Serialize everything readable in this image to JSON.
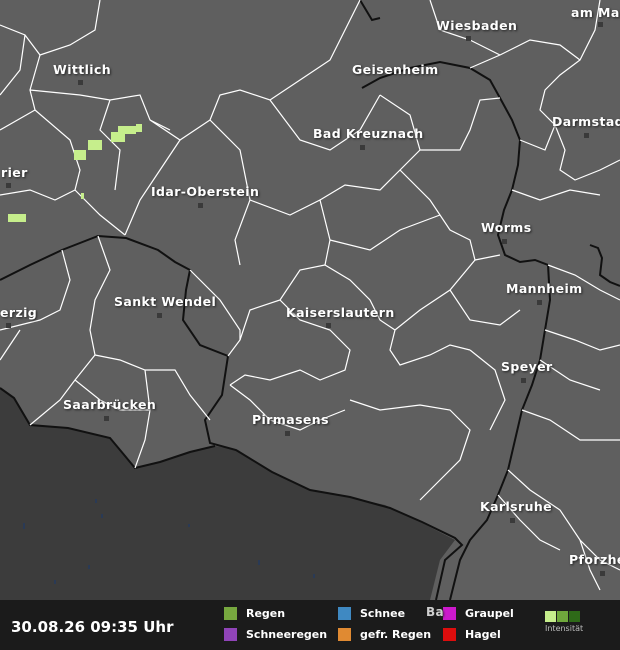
{
  "timestamp": "30.08.26 09:35 Uhr",
  "cities": [
    {
      "name": "Wittlich"
    },
    {
      "name": "Wiesbaden"
    },
    {
      "name": "am Mai"
    },
    {
      "name": "Geisenheim"
    },
    {
      "name": "Bad Kreuznach"
    },
    {
      "name": "Darmstadt"
    },
    {
      "name": "rier"
    },
    {
      "name": "Idar-Oberstein"
    },
    {
      "name": "Worms"
    },
    {
      "name": "Mannheim"
    },
    {
      "name": "Sankt Wendel"
    },
    {
      "name": "erzig"
    },
    {
      "name": "Kaiserslautern"
    },
    {
      "name": "Speyer"
    },
    {
      "name": "Saarbrücken"
    },
    {
      "name": "Pirmasens"
    },
    {
      "name": "Karlsruhe"
    },
    {
      "name": "Pforzhe"
    },
    {
      "name": "Ba"
    }
  ],
  "legend": {
    "rain": {
      "label": "Regen",
      "color": "#77a83f"
    },
    "snow": {
      "label": "Schnee",
      "color": "#3f89c2"
    },
    "graupel": {
      "label": "Graupel",
      "color": "#cc19cc"
    },
    "sleet": {
      "label": "Schneeregen",
      "color": "#9044b8"
    },
    "freezing_rain": {
      "label": "gefr. Regen",
      "color": "#e08a32"
    },
    "hail": {
      "label": "Hagel",
      "color": "#dd0d0d"
    },
    "intensity_label": "Intensität",
    "intensity_colors": [
      "#c6ee8c",
      "#6fa83c",
      "#2e6a18"
    ]
  },
  "colors": {
    "land": "#5f5f5f",
    "outside_area": "#3c3c3c",
    "borders": "#ffffff",
    "country_border": "#111111",
    "precip": "#c6ee8c"
  }
}
